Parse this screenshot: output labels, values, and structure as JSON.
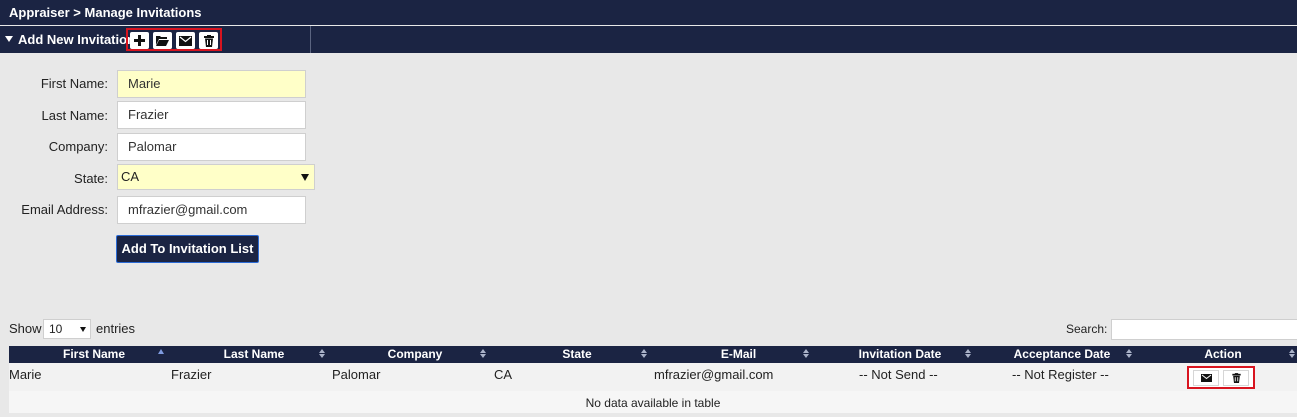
{
  "header": {
    "breadcrumb": "Appraiser > Manage Invitations"
  },
  "section": {
    "title": "Add New Invitation",
    "toolbar": [
      "plus-icon",
      "folder-open-icon",
      "envelope-icon",
      "trash-icon"
    ]
  },
  "form": {
    "first_name": {
      "label": "First Name:",
      "value": "Marie"
    },
    "last_name": {
      "label": "Last Name:",
      "value": "Frazier"
    },
    "company": {
      "label": "Company:",
      "value": "Palomar"
    },
    "state": {
      "label": "State:",
      "value": "CA"
    },
    "email": {
      "label": "Email Address:",
      "value": "mfrazier@gmail.com"
    },
    "submit_label": "Add To Invitation List"
  },
  "table_controls": {
    "show_label": "Show",
    "page_length": "10",
    "entries_label": "entries",
    "search_label": "Search:",
    "search_value": ""
  },
  "table": {
    "columns": [
      "First Name",
      "Last Name",
      "Company",
      "State",
      "E-Mail",
      "Invitation Date",
      "Acceptance Date",
      "Action"
    ],
    "rows": [
      {
        "first_name": "Marie",
        "last_name": "Frazier",
        "company": "Palomar",
        "state": "CA",
        "email": "mfrazier@gmail.com",
        "invitation_date": "-- Not Send --",
        "acceptance_date": "-- Not Register --",
        "actions": [
          "envelope-icon",
          "trash-icon"
        ]
      }
    ],
    "empty_message": "No data available in table"
  },
  "colors": {
    "header_bg": "#1b2443",
    "highlight_border": "#d8141f",
    "required_field_bg": "#ffffc8"
  }
}
